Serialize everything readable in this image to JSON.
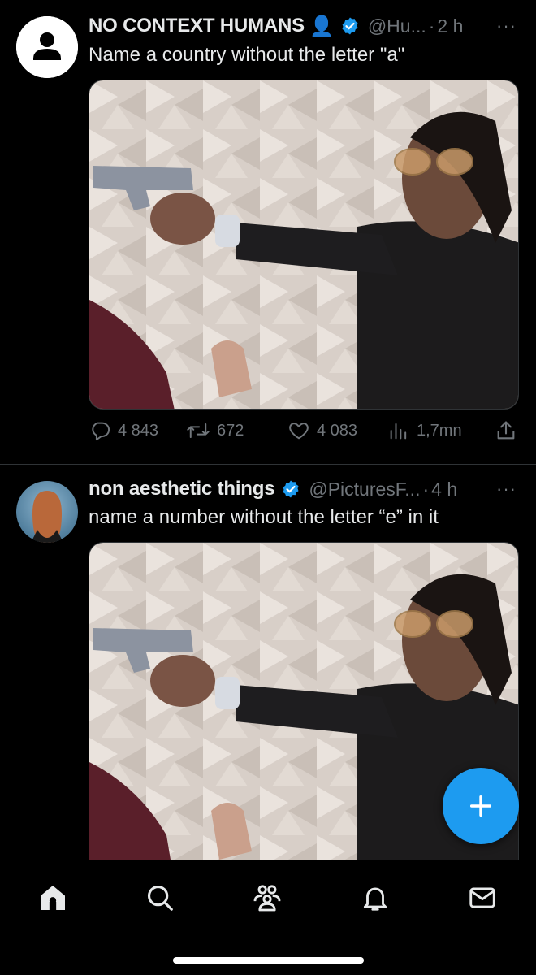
{
  "tweets": [
    {
      "author_name": "NO CONTEXT HUMANS",
      "author_emoji": "👤",
      "handle": "@Hu...",
      "separator": "·",
      "time": "2 h",
      "more": "···",
      "text": "Name a country without the letter \"a\"",
      "verified": true,
      "stats": {
        "replies": "4 843",
        "retweets": "672",
        "likes": "4 083",
        "views": "1,7mn"
      }
    },
    {
      "author_name": "non aesthetic things",
      "handle": "@PicturesF...",
      "separator": "·",
      "time": "4 h",
      "more": "···",
      "text": "name a number without the letter “e” in it",
      "verified": true
    }
  ],
  "icons": {
    "reply": "reply-icon",
    "retweet": "retweet-icon",
    "like": "like-icon",
    "views": "views-icon",
    "share": "share-icon",
    "compose": "compose-plus-icon",
    "nav": [
      "home-icon",
      "search-icon",
      "communities-icon",
      "notifications-icon",
      "messages-icon"
    ]
  },
  "colors": {
    "background": "#000000",
    "text": "#e7e9ea",
    "muted": "#71767b",
    "accent": "#1d9bf0"
  }
}
